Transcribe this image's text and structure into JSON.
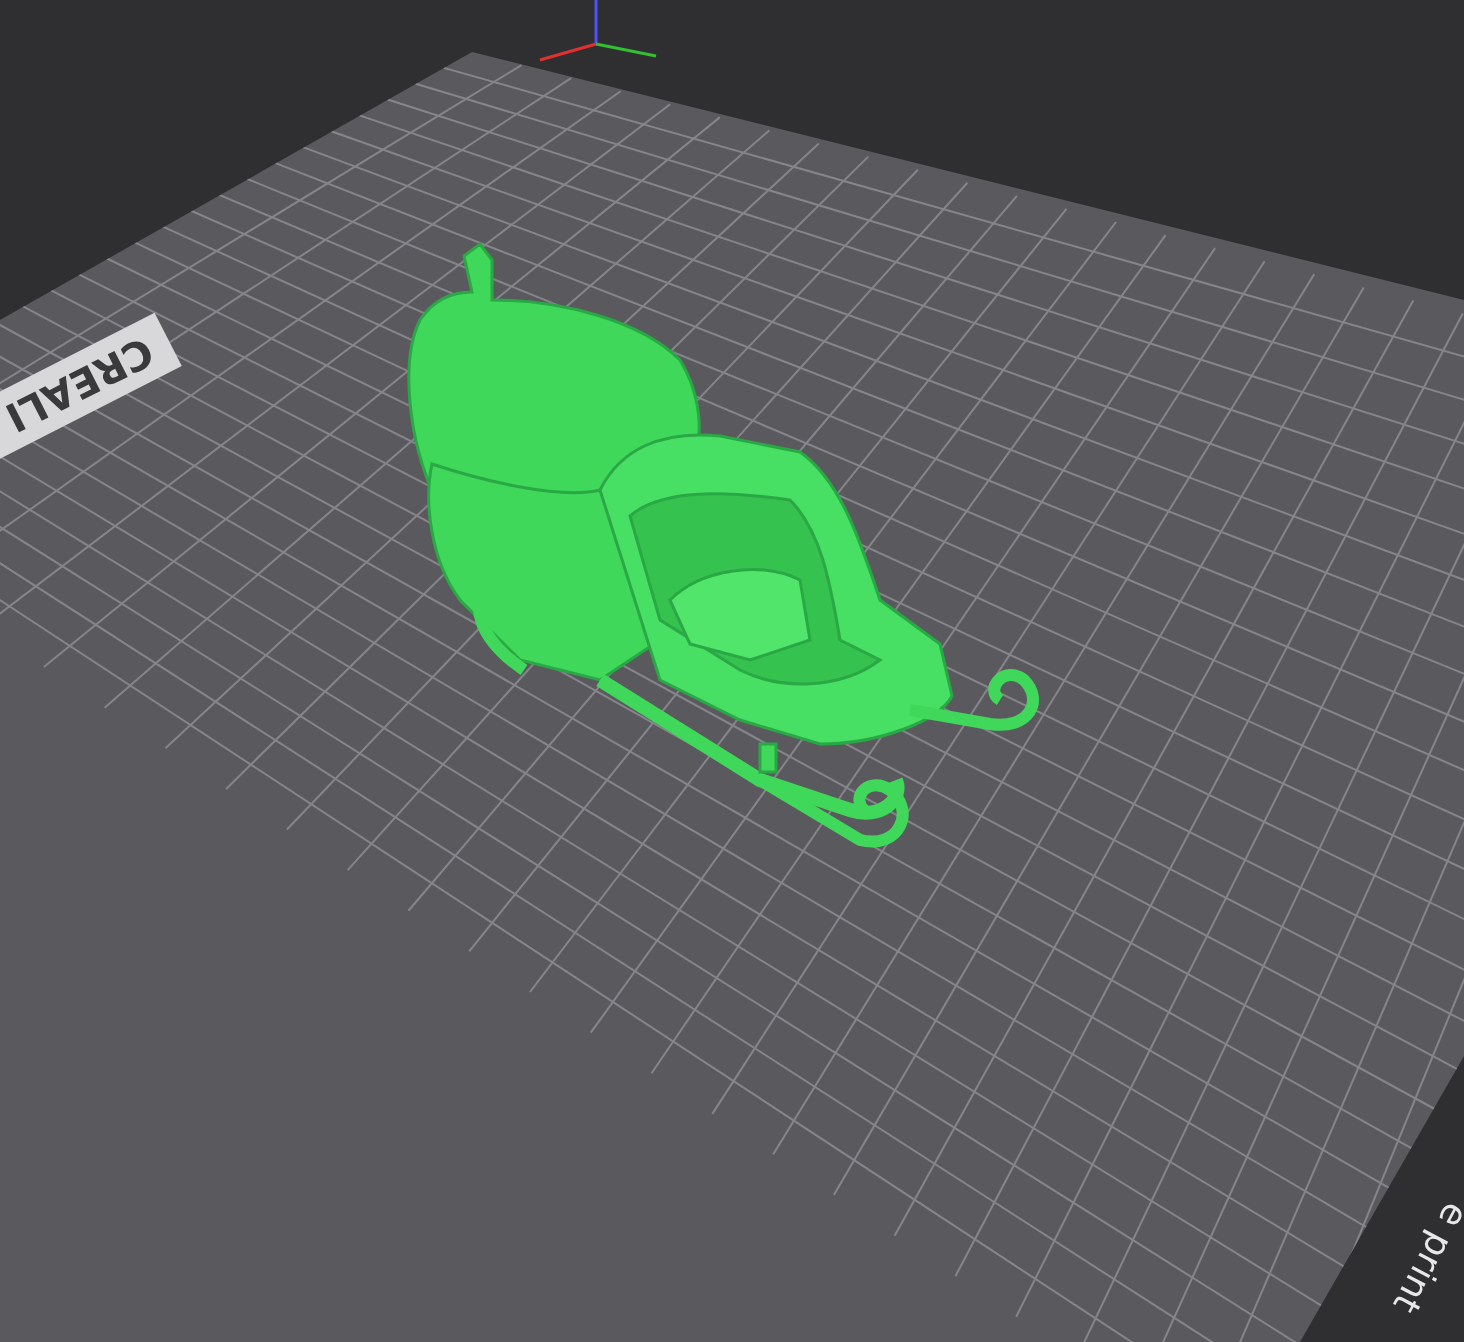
{
  "viewport": {
    "plate_labels": [
      {
        "kind": "brand",
        "text": "CREALI"
      },
      {
        "kind": "edge",
        "text": "e print"
      }
    ]
  }
}
